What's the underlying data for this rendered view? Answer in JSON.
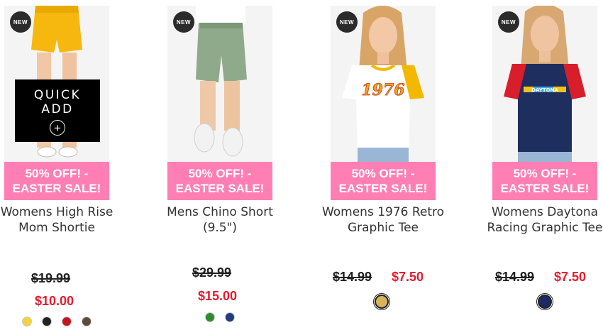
{
  "products": [
    {
      "title": "Womens High Rise Mom Shortie",
      "badge": "NEW",
      "sale_banner": "50% OFF! - EASTER SALE!",
      "quick_add": "QUICK ADD",
      "price_original": "$19.99",
      "price_sale": "$10.00",
      "swatches": [
        "#f3d23c",
        "#222222",
        "#c4161c",
        "#5c4a3b"
      ]
    },
    {
      "title": "Mens Chino Short (9.5\")",
      "badge": "NEW",
      "sale_banner": "50% OFF! - EASTER SALE!",
      "price_original": "$29.99",
      "price_sale": "$15.00",
      "swatches": [
        "#2e8b2e",
        "#1f3f7a"
      ]
    },
    {
      "title": "Womens 1976 Retro Graphic Tee",
      "badge": "NEW",
      "sale_banner": "50% OFF! - EASTER SALE!",
      "price_original": "$14.99",
      "price_sale": "$7.50",
      "swatches": [
        "#d9b45a"
      ]
    },
    {
      "title": "Womens Daytona Racing Graphic Tee",
      "badge": "NEW",
      "sale_banner": "50% OFF! - EASTER SALE!",
      "price_original": "$14.99",
      "price_sale": "$7.50",
      "swatches": [
        "#1b2a66"
      ]
    }
  ],
  "colors": {
    "banner": "#ff7fb4",
    "sale_price": "#e8192c"
  }
}
